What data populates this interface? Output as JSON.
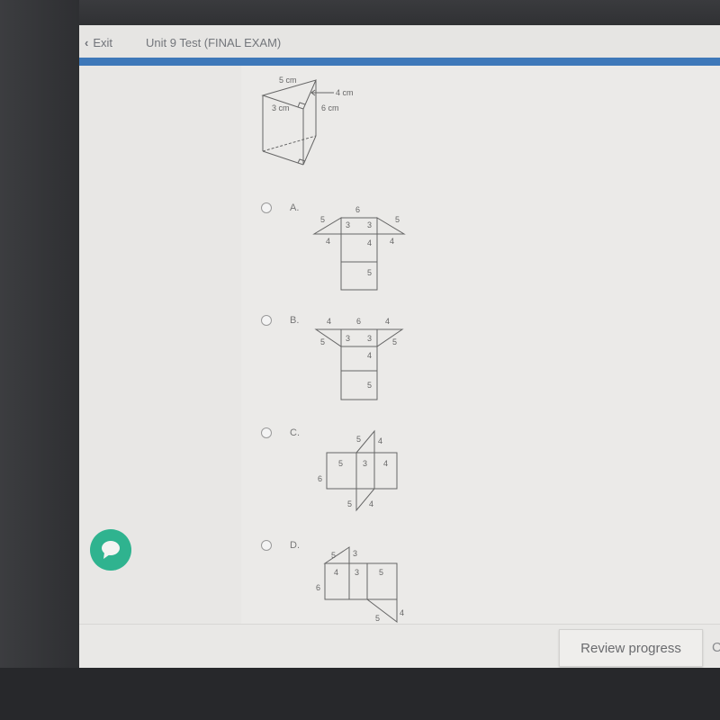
{
  "header": {
    "exit_label": "Exit",
    "title": "Unit 9 Test (FINAL EXAM)"
  },
  "figure": {
    "labels": {
      "top": "5 cm",
      "right_arrow": "4 cm",
      "left": "3 cm",
      "height": "6 cm"
    }
  },
  "options": [
    {
      "letter": "A.",
      "labels": {
        "top": "6",
        "ul": "5",
        "ur": "5",
        "in_l": "3",
        "in_r": "3",
        "bl": "4",
        "br": "4",
        "mid": "4",
        "bottom": "5"
      }
    },
    {
      "letter": "B.",
      "labels": {
        "tl": "4",
        "top": "6",
        "tr": "4",
        "ll": "5",
        "lr": "5",
        "in_l": "3",
        "in_r": "3",
        "mid": "4",
        "bottom": "5"
      }
    },
    {
      "letter": "C.",
      "labels": {
        "tri_top_hyp": "5",
        "tri_top_leg": "4",
        "rect_l": "5",
        "rect_m": "3",
        "rect_r": "4",
        "height": "6",
        "tri_bot_hyp": "5",
        "tri_bot_leg": "4"
      }
    },
    {
      "letter": "D.",
      "labels": {
        "tri_top_hyp": "5",
        "tri_top_leg": "3",
        "rect_l": "4",
        "rect_m": "3",
        "rect_r": "5",
        "height": "6",
        "tri_bot_hyp": "5",
        "tri_bot_leg": "4"
      }
    }
  ],
  "footer": {
    "review_label": "Review progress",
    "next_partial": "C"
  },
  "colors": {
    "accent_bar": "#3e78b9",
    "chat_button": "#2fb38f"
  }
}
